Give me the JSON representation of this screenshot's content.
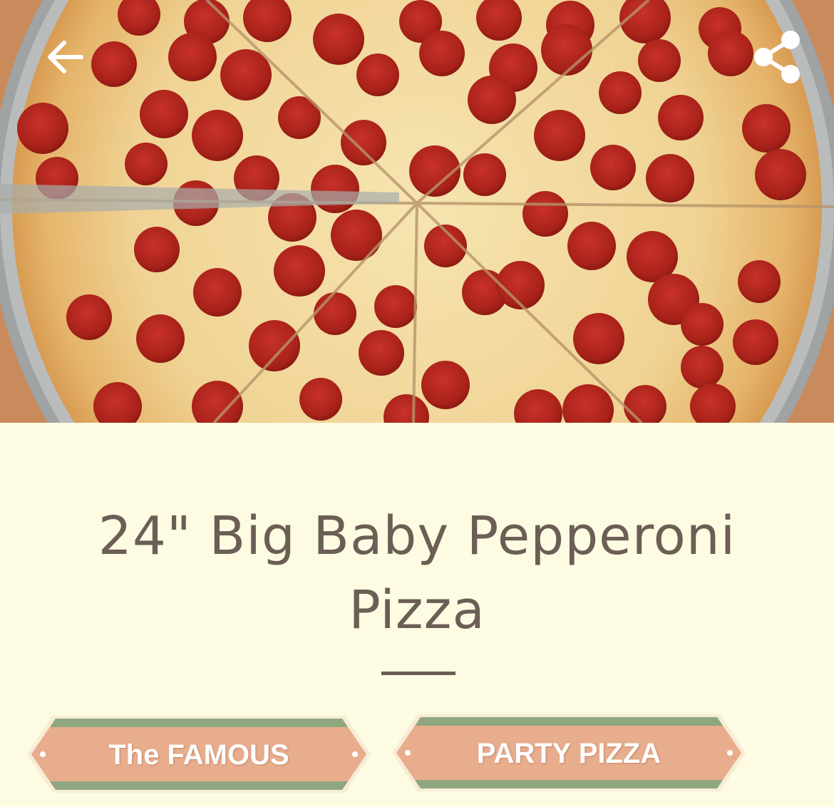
{
  "header": {
    "back_icon": "arrow-left-icon",
    "share_icon": "share-icon"
  },
  "product": {
    "title_line1": "24\" Big Baby Pepperoni",
    "title_line2": "Pizza",
    "image": "pepperoni-pizza-photo"
  },
  "tags": [
    {
      "label": "The FAMOUS"
    },
    {
      "label": "PARTY PIZZA"
    }
  ],
  "colors": {
    "background": "#fdfbe2",
    "title_text": "#6b5e55",
    "tag_fill": "#e8ad8c",
    "tag_stripe": "#8fa77f"
  }
}
